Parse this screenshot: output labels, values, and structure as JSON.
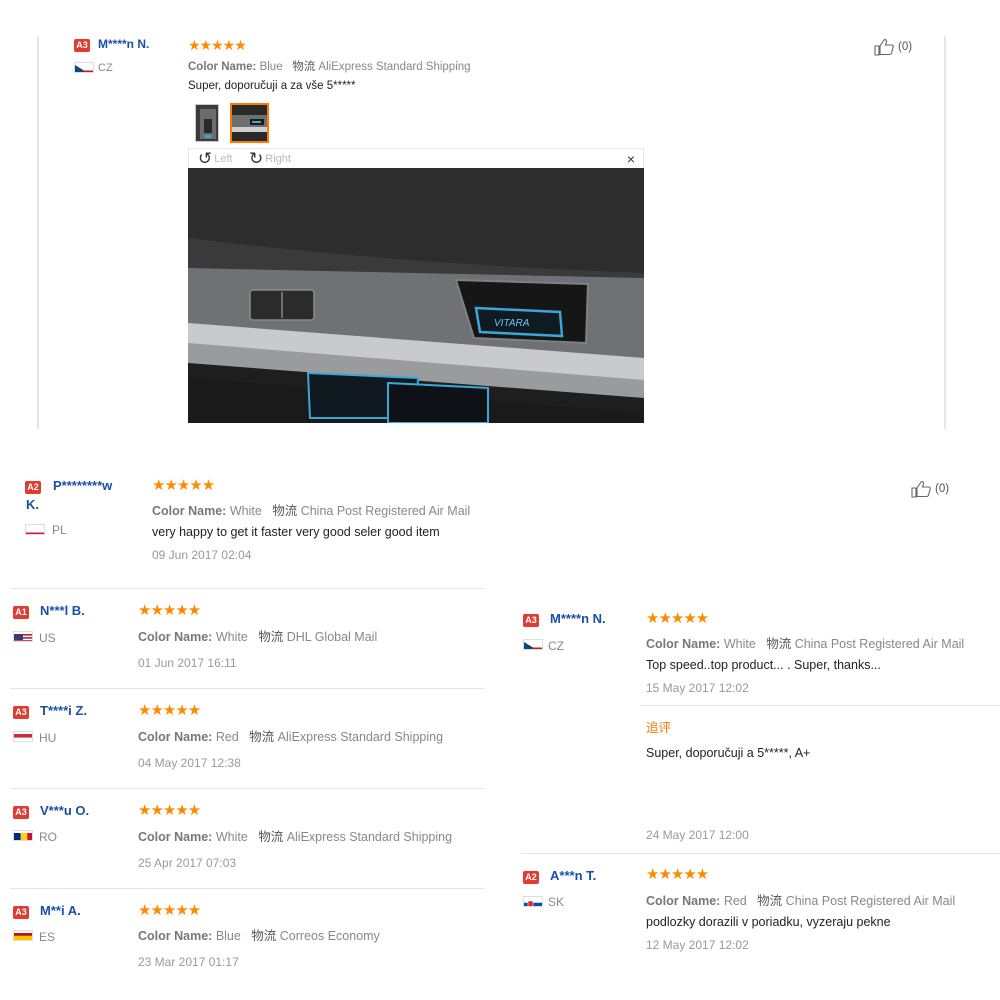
{
  "review_top": {
    "badge": "A3",
    "user": "M****n N.",
    "country": "CZ",
    "stars": "★★★★★",
    "color_label": "Color Name:",
    "color_value": "Blue",
    "logistics_label": "物流",
    "logistics_value": "AliExpress Standard Shipping",
    "text": "Super, doporučuji a za vše 5*****",
    "like": "(0)",
    "viewer": {
      "left": "Left",
      "right": "Right",
      "close": "×"
    },
    "photo_caption": "VITARA"
  },
  "review_a2": {
    "badge": "A2",
    "user": "P********w",
    "user_line2": "K.",
    "country": "PL",
    "stars": "★★★★★",
    "color_label": "Color Name:",
    "color_value": "White",
    "logistics_label": "物流",
    "logistics_value": "China Post Registered Air Mail",
    "text": "very happy to get it faster very good seler good item",
    "date": "09 Jun 2017 02:04",
    "like": "(0)"
  },
  "left_reviews": [
    {
      "badge": "A1",
      "user": "N***l B.",
      "country": "US",
      "stars": "★★★★★",
      "color_label": "Color Name:",
      "color_value": "White",
      "logistics_label": "物流",
      "logistics_value": "DHL Global Mail",
      "date": "01 Jun 2017 16:11"
    },
    {
      "badge": "A3",
      "user": "T****i Z.",
      "country": "HU",
      "stars": "★★★★★",
      "color_label": "Color Name:",
      "color_value": "Red",
      "logistics_label": "物流",
      "logistics_value": "AliExpress Standard Shipping",
      "date": "04 May 2017 12:38"
    },
    {
      "badge": "A3",
      "user": "V***u O.",
      "country": "RO",
      "stars": "★★★★★",
      "color_label": "Color Name:",
      "color_value": "White",
      "logistics_label": "物流",
      "logistics_value": "AliExpress Standard Shipping",
      "date": "25 Apr 2017 07:03"
    },
    {
      "badge": "A3",
      "user": "M**i A.",
      "country": "ES",
      "stars": "★★★★★",
      "color_label": "Color Name:",
      "color_value": "Blue",
      "logistics_label": "物流",
      "logistics_value": "Correos Economy",
      "date": "23 Mar 2017 01:17"
    }
  ],
  "right_reviews": [
    {
      "badge": "A3",
      "user": "M****n N.",
      "country": "CZ",
      "stars": "★★★★★",
      "color_label": "Color Name:",
      "color_value": "White",
      "logistics_label": "物流",
      "logistics_value": "China Post Registered Air Mail",
      "text": "Top speed..top product... . Super, thanks...",
      "date": "15 May 2017 12:02",
      "followup_label": "追评",
      "followup_text": "Super, doporučuji a 5*****, A+",
      "followup_date": "24 May 2017 12:00"
    },
    {
      "badge": "A2",
      "user": "A***n T.",
      "country": "SK",
      "stars": "★★★★★",
      "color_label": "Color Name:",
      "color_value": "Red",
      "logistics_label": "物流",
      "logistics_value": "China Post Registered Air Mail",
      "text": "podlozky dorazili v poriadku, vyzeraju pekne",
      "date": "12 May 2017 12:02"
    }
  ],
  "colors": {
    "star": "#ff8a00",
    "badge": "#e03c31",
    "user": "#1a4ea8",
    "followup": "#ff7a00"
  }
}
